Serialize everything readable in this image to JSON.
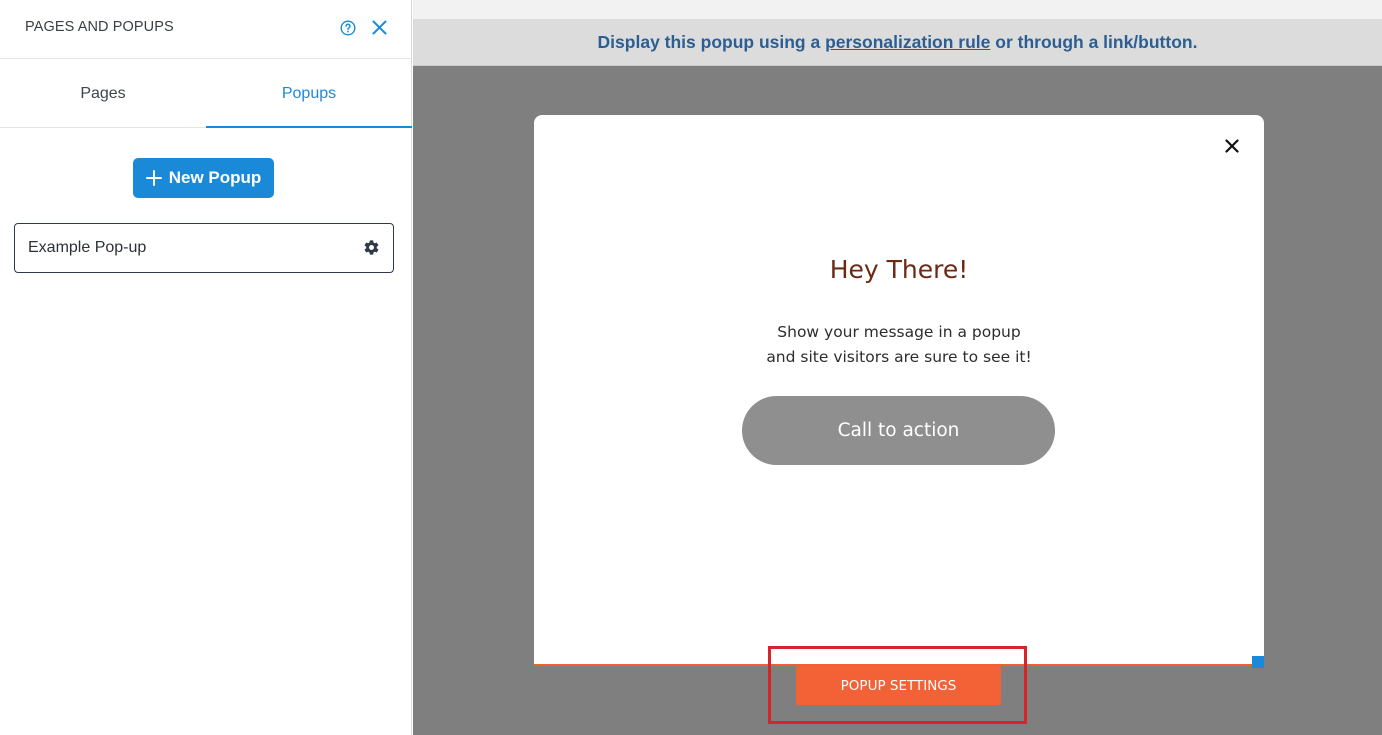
{
  "panel": {
    "title": "PAGES AND POPUPS",
    "tabs": [
      {
        "label": "Pages",
        "active": false
      },
      {
        "label": "Popups",
        "active": true
      }
    ],
    "new_popup_label": "New Popup",
    "popups": [
      {
        "label": "Example Pop-up"
      }
    ]
  },
  "editor": {
    "info_bar": {
      "prefix": "Display this popup using a ",
      "link": "personalization rule",
      "suffix": " or through a link/button."
    },
    "popup": {
      "heading": "Hey There!",
      "message_line1": "Show your message in a popup",
      "message_line2": "and site visitors are sure to see it!",
      "cta_label": "Call to action"
    },
    "settings_button_label": "POPUP SETTINGS"
  },
  "colors": {
    "accent_blue": "#1a8ad8",
    "settings_orange": "#f26236",
    "heading_brown": "#6b2a14",
    "highlight_red": "#d8232a",
    "info_text_blue": "#2b5f94"
  },
  "icons": [
    "help-icon",
    "close-icon",
    "plus-icon",
    "gear-icon",
    "popup-close-icon"
  ]
}
